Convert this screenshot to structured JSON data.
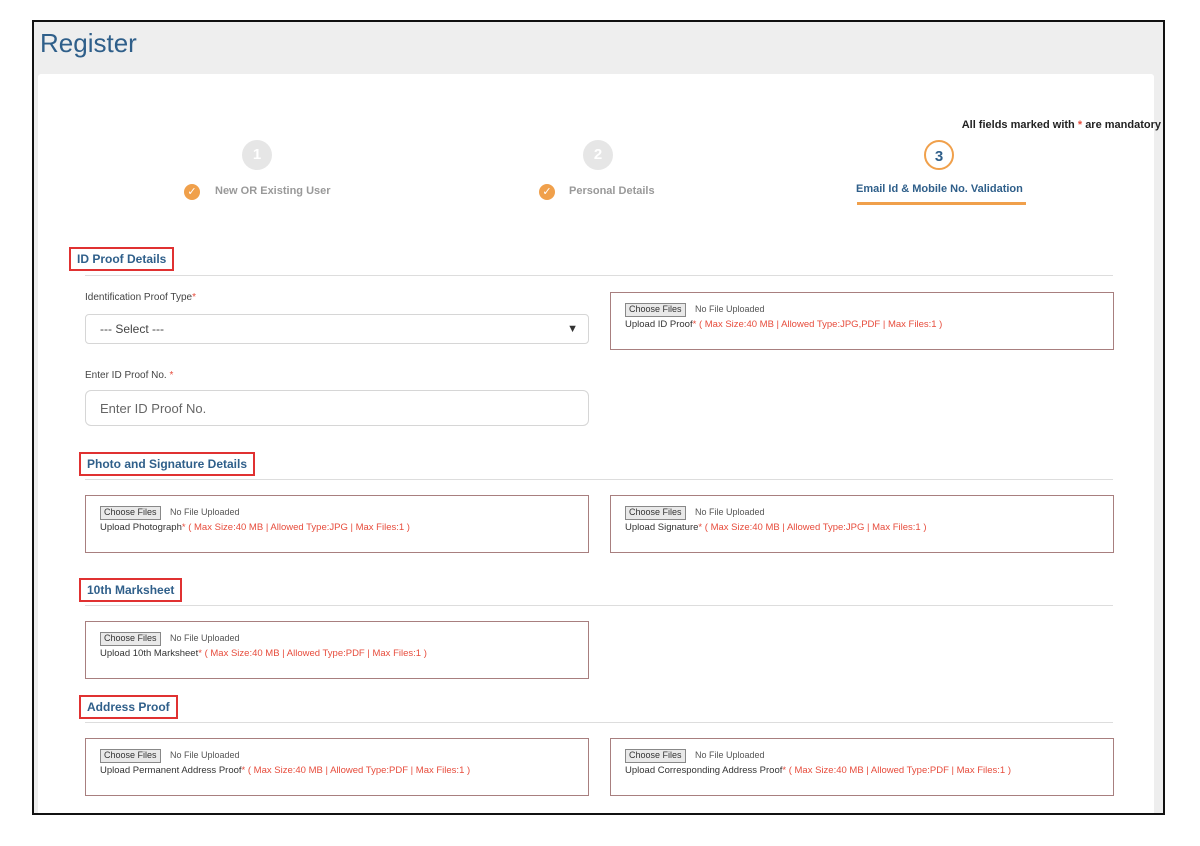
{
  "page": {
    "title": "Register"
  },
  "mandatory_note": {
    "prefix": "All fields marked with",
    "star": "*",
    "suffix": "are mandatory"
  },
  "steps": [
    {
      "number": "1",
      "label": "New OR Existing User",
      "completed": true
    },
    {
      "number": "2",
      "label": "Personal Details",
      "completed": true
    },
    {
      "number": "3",
      "label": "Email Id & Mobile No. Validation",
      "completed": false,
      "active": true
    }
  ],
  "id_proof": {
    "title": "ID Proof Details",
    "type_label": "Identification Proof Type",
    "type_selected": "--- Select ---",
    "number_label": "Enter ID Proof No.",
    "number_placeholder": "Enter ID Proof No.",
    "upload": {
      "button": "Choose Files",
      "status": "No File Uploaded",
      "label": "Upload ID Proof",
      "info": "( Max Size:40 MB | Allowed Type:JPG,PDF | Max Files:1 )"
    }
  },
  "photo_signature": {
    "title": "Photo and Signature Details",
    "photo": {
      "button": "Choose Files",
      "status": "No File Uploaded",
      "label": "Upload Photograph",
      "info": "( Max Size:40 MB | Allowed Type:JPG | Max Files:1 )"
    },
    "signature": {
      "button": "Choose Files",
      "status": "No File Uploaded",
      "label": "Upload Signature",
      "info": "( Max Size:40 MB | Allowed Type:JPG | Max Files:1 )"
    }
  },
  "marksheet": {
    "title": "10th Marksheet",
    "upload": {
      "button": "Choose Files",
      "status": "No File Uploaded",
      "label": "Upload 10th Marksheet",
      "info": "( Max Size:40 MB | Allowed Type:PDF | Max Files:1 )"
    }
  },
  "address": {
    "title": "Address Proof",
    "permanent": {
      "button": "Choose Files",
      "status": "No File Uploaded",
      "label": "Upload Permanent Address Proof",
      "info": "( Max Size:40 MB | Allowed Type:PDF | Max Files:1 )"
    },
    "corresponding": {
      "button": "Choose Files",
      "status": "No File Uploaded",
      "label": "Upload Corresponding Address Proof",
      "info": "( Max Size:40 MB | Allowed Type:PDF | Max Files:1 )"
    }
  },
  "colors": {
    "accent": "#f0a04b",
    "heading": "#2f5f8a",
    "required": "#e74c3c",
    "highlight_border": "#e03131"
  }
}
